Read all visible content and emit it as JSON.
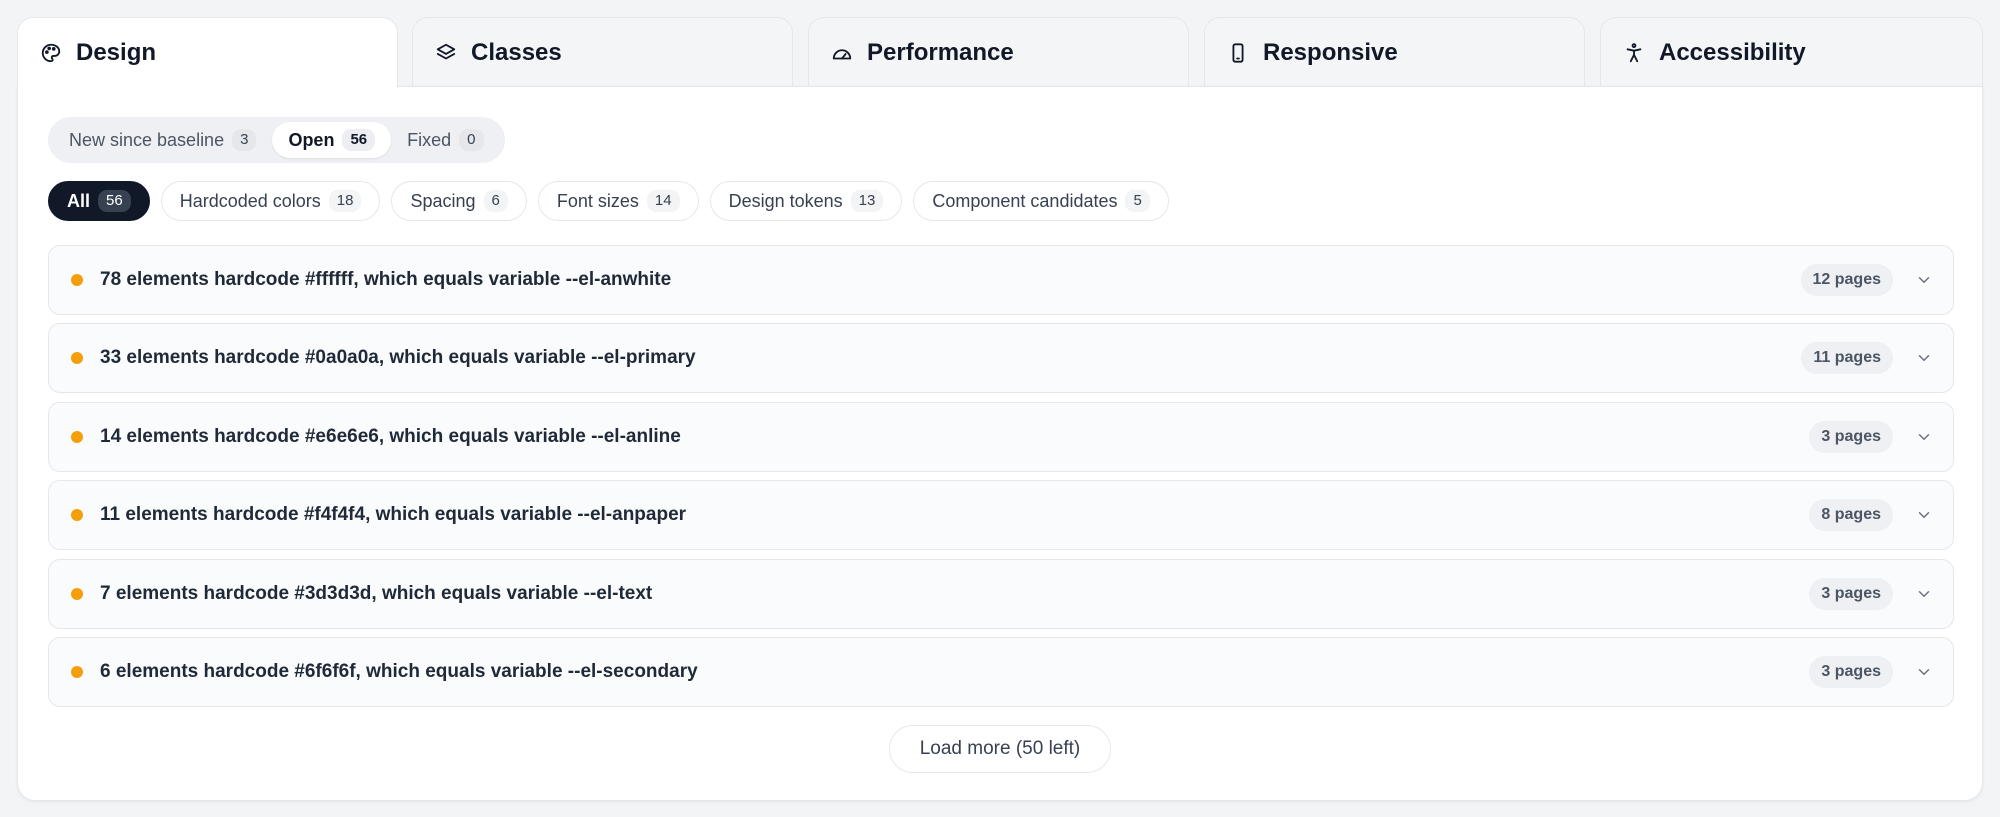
{
  "tabs": [
    {
      "label": "Design",
      "icon": "palette-icon",
      "active": true
    },
    {
      "label": "Classes",
      "icon": "layers-icon",
      "active": false
    },
    {
      "label": "Performance",
      "icon": "gauge-icon",
      "active": false
    },
    {
      "label": "Responsive",
      "icon": "smartphone-icon",
      "active": false
    },
    {
      "label": "Accessibility",
      "icon": "accessibility-icon",
      "active": false
    }
  ],
  "status_filter": {
    "selected": "Open",
    "options": [
      {
        "label": "New since baseline",
        "count": "3"
      },
      {
        "label": "Open",
        "count": "56"
      },
      {
        "label": "Fixed",
        "count": "0"
      }
    ]
  },
  "categories": {
    "selected": "All",
    "options": [
      {
        "label": "All",
        "count": "56"
      },
      {
        "label": "Hardcoded colors",
        "count": "18"
      },
      {
        "label": "Spacing",
        "count": "6"
      },
      {
        "label": "Font sizes",
        "count": "14"
      },
      {
        "label": "Design tokens",
        "count": "13"
      },
      {
        "label": "Component candidates",
        "count": "5"
      }
    ]
  },
  "issues": [
    {
      "text": "78 elements hardcode #ffffff, which equals variable --el-anwhite",
      "pages": "12 pages"
    },
    {
      "text": "33 elements hardcode #0a0a0a, which equals variable --el-primary",
      "pages": "11 pages"
    },
    {
      "text": "14 elements hardcode #e6e6e6, which equals variable --el-anline",
      "pages": "3 pages"
    },
    {
      "text": "11 elements hardcode #f4f4f4, which equals variable --el-anpaper",
      "pages": "8 pages"
    },
    {
      "text": "7 elements hardcode #3d3d3d, which equals variable --el-text",
      "pages": "3 pages"
    },
    {
      "text": "6 elements hardcode #6f6f6f, which equals variable --el-secondary",
      "pages": "3 pages"
    }
  ],
  "load_more_label": "Load more (50 left)",
  "colors": {
    "severity_dot": "#f59e0b",
    "active_chip": "#111827"
  }
}
